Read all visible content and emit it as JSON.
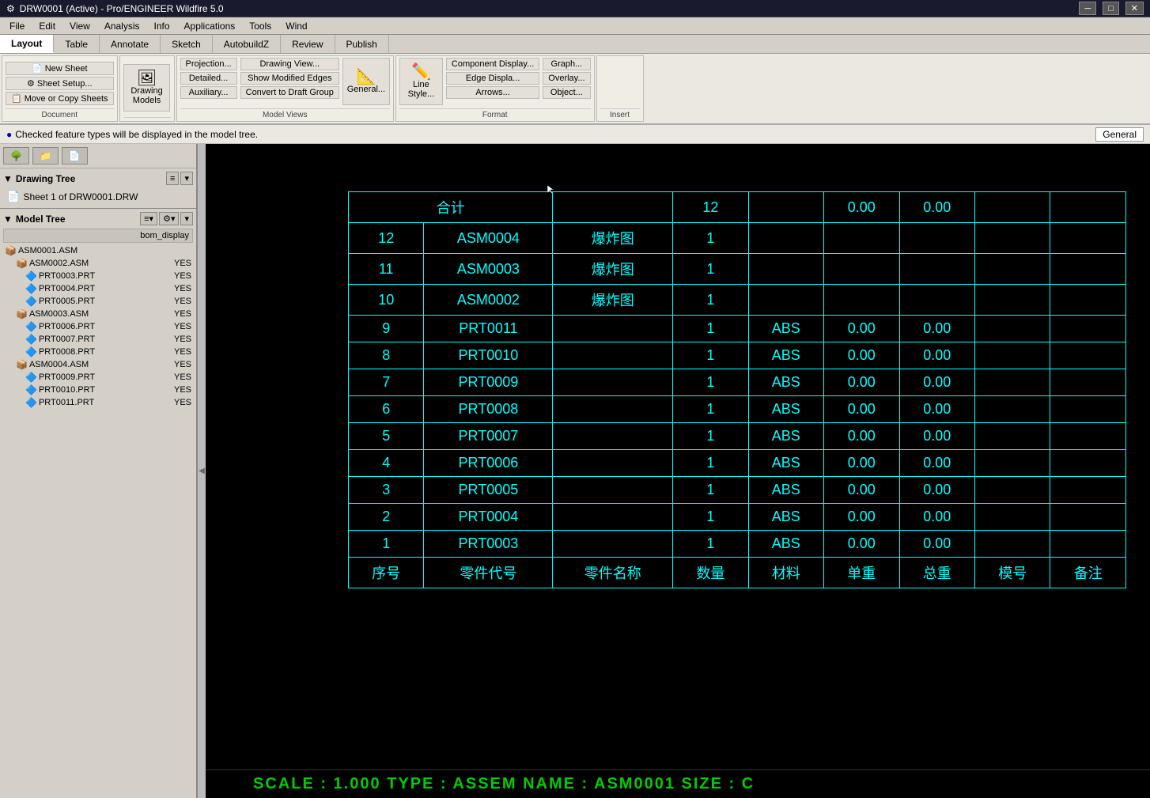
{
  "titleBar": {
    "title": "DRW0001 (Active) - Pro/ENGINEER Wildfire 5.0",
    "buttons": [
      "─",
      "□",
      "✕"
    ]
  },
  "menuBar": {
    "items": [
      "File",
      "Edit",
      "View",
      "Analysis",
      "Info",
      "Applications",
      "Tools",
      "Wind"
    ]
  },
  "toolbarTabs": {
    "items": [
      "Layout",
      "Table",
      "Annotate",
      "Sketch",
      "AutobuildZ",
      "Review",
      "Publish"
    ],
    "active": 0
  },
  "ribbon": {
    "groups": [
      {
        "label": "Document",
        "buttons": [
          "New Sheet",
          "Sheet Setup...",
          "Move or Copy Sheets"
        ]
      },
      {
        "label": "Model Views",
        "buttons": [
          "Projection...",
          "Drawing View...",
          "Detailed...",
          "Show Modified Edges",
          "Auxiliary...",
          "Convert to Draft Group",
          "General..."
        ]
      },
      {
        "label": "Format",
        "buttons": [
          "Component Display...",
          "Graph...",
          "Edge Displa...",
          "Overlay...",
          "Arrows...",
          "Object..."
        ],
        "hasLineStyle": true
      },
      {
        "label": "Insert",
        "buttons": []
      }
    ]
  },
  "infoBar": {
    "message": "Checked feature types will be displayed in the model tree.",
    "generalLabel": "General"
  },
  "drawingTree": {
    "title": "Drawing Tree",
    "items": [
      "Sheet 1 of DRW0001.DRW"
    ]
  },
  "modelTree": {
    "title": "Model Tree",
    "columnHeader": "bom_display",
    "items": [
      {
        "name": "ASM0001.ASM",
        "depth": 0,
        "type": "asm",
        "value": ""
      },
      {
        "name": "ASM0002.ASM",
        "depth": 1,
        "type": "asm",
        "value": "YES"
      },
      {
        "name": "PRT0003.PRT",
        "depth": 2,
        "type": "prt",
        "value": "YES"
      },
      {
        "name": "PRT0004.PRT",
        "depth": 2,
        "type": "prt",
        "value": "YES"
      },
      {
        "name": "PRT0005.PRT",
        "depth": 2,
        "type": "prt",
        "value": "YES"
      },
      {
        "name": "ASM0003.ASM",
        "depth": 1,
        "type": "asm",
        "value": "YES"
      },
      {
        "name": "PRT0006.PRT",
        "depth": 2,
        "type": "prt",
        "value": "YES"
      },
      {
        "name": "PRT0007.PRT",
        "depth": 2,
        "type": "prt",
        "value": "YES"
      },
      {
        "name": "PRT0008.PRT",
        "depth": 2,
        "type": "prt",
        "value": "YES"
      },
      {
        "name": "ASM0004.ASM",
        "depth": 1,
        "type": "asm",
        "value": "YES"
      },
      {
        "name": "PRT0009.PRT",
        "depth": 2,
        "type": "prt",
        "value": "YES"
      },
      {
        "name": "PRT0010.PRT",
        "depth": 2,
        "type": "prt",
        "value": "YES"
      },
      {
        "name": "PRT0011.PRT",
        "depth": 2,
        "type": "prt",
        "value": "YES"
      }
    ]
  },
  "bomTable": {
    "totalRow": {
      "label": "合计",
      "qty": "12",
      "unitWeight": "0.00",
      "totalWeight": "0.00"
    },
    "rows": [
      {
        "seq": "12",
        "partCode": "ASM0004",
        "partName": "爆炸图",
        "qty": "1",
        "material": "",
        "unitWeight": "",
        "totalWeight": "",
        "model": "",
        "remark": ""
      },
      {
        "seq": "11",
        "partCode": "ASM0003",
        "partName": "爆炸图",
        "qty": "1",
        "material": "",
        "unitWeight": "",
        "totalWeight": "",
        "model": "",
        "remark": ""
      },
      {
        "seq": "10",
        "partCode": "ASM0002",
        "partName": "爆炸图",
        "qty": "1",
        "material": "",
        "unitWeight": "",
        "totalWeight": "",
        "model": "",
        "remark": ""
      },
      {
        "seq": "9",
        "partCode": "PRT0011",
        "partName": "",
        "qty": "1",
        "material": "ABS",
        "unitWeight": "0.00",
        "totalWeight": "0.00",
        "model": "",
        "remark": ""
      },
      {
        "seq": "8",
        "partCode": "PRT0010",
        "partName": "",
        "qty": "1",
        "material": "ABS",
        "unitWeight": "0.00",
        "totalWeight": "0.00",
        "model": "",
        "remark": ""
      },
      {
        "seq": "7",
        "partCode": "PRT0009",
        "partName": "",
        "qty": "1",
        "material": "ABS",
        "unitWeight": "0.00",
        "totalWeight": "0.00",
        "model": "",
        "remark": ""
      },
      {
        "seq": "6",
        "partCode": "PRT0008",
        "partName": "",
        "qty": "1",
        "material": "ABS",
        "unitWeight": "0.00",
        "totalWeight": "0.00",
        "model": "",
        "remark": ""
      },
      {
        "seq": "5",
        "partCode": "PRT0007",
        "partName": "",
        "qty": "1",
        "material": "ABS",
        "unitWeight": "0.00",
        "totalWeight": "0.00",
        "model": "",
        "remark": ""
      },
      {
        "seq": "4",
        "partCode": "PRT0006",
        "partName": "",
        "qty": "1",
        "material": "ABS",
        "unitWeight": "0.00",
        "totalWeight": "0.00",
        "model": "",
        "remark": ""
      },
      {
        "seq": "3",
        "partCode": "PRT0005",
        "partName": "",
        "qty": "1",
        "material": "ABS",
        "unitWeight": "0.00",
        "totalWeight": "0.00",
        "model": "",
        "remark": ""
      },
      {
        "seq": "2",
        "partCode": "PRT0004",
        "partName": "",
        "qty": "1",
        "material": "ABS",
        "unitWeight": "0.00",
        "totalWeight": "0.00",
        "model": "",
        "remark": ""
      },
      {
        "seq": "1",
        "partCode": "PRT0003",
        "partName": "",
        "qty": "1",
        "material": "ABS",
        "unitWeight": "0.00",
        "totalWeight": "0.00",
        "model": "",
        "remark": ""
      }
    ],
    "headerRow": {
      "seq": "序号",
      "partCode": "零件代号",
      "partName": "零件名称",
      "qty": "数量",
      "material": "材料",
      "unitWeight": "单重",
      "totalWeight": "总重",
      "model": "模号",
      "remark": "备注"
    }
  },
  "statusBar": {
    "text": "SCALE : 1.000     TYPE : ASSEM     NAME : ASM0001     SIZE : C"
  }
}
